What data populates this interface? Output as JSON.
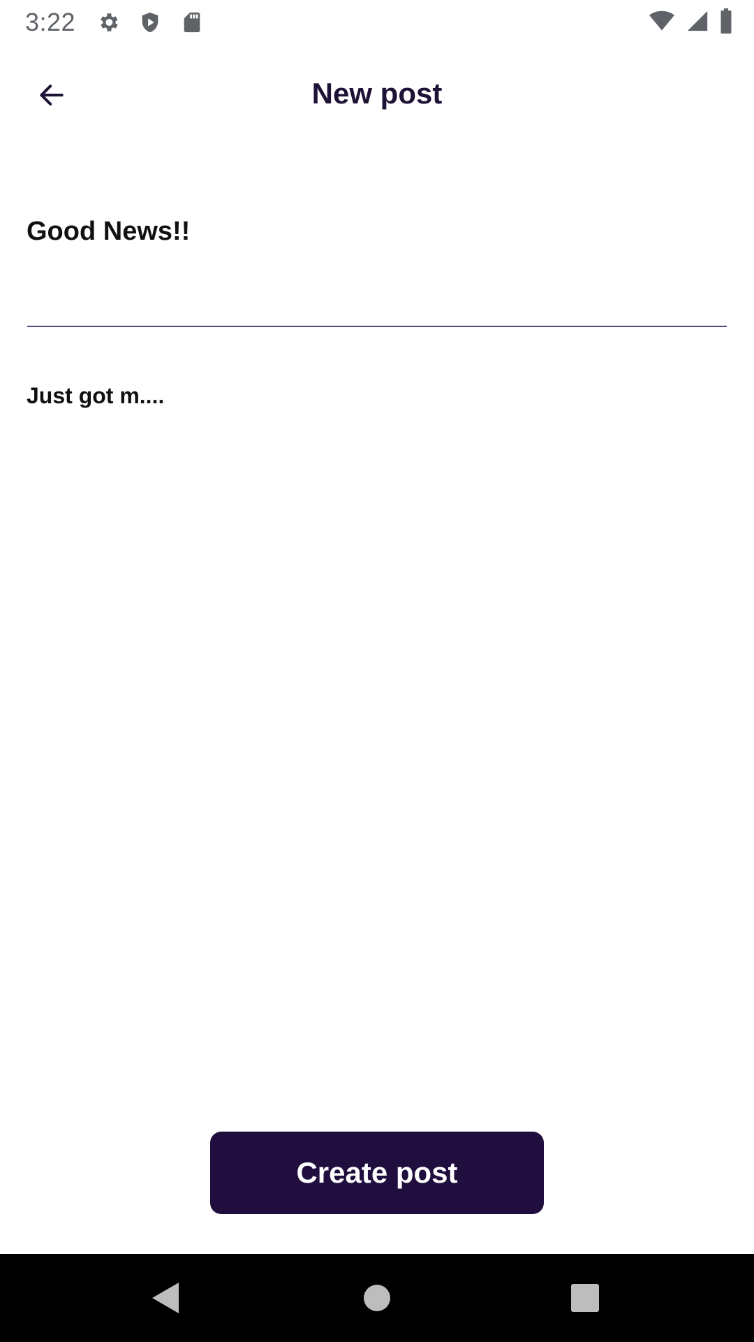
{
  "status_bar": {
    "time": "3:22",
    "left_icons": [
      "gear-icon",
      "shield-play-icon",
      "sd-card-icon"
    ],
    "right_icons": [
      "wifi-icon",
      "cell-signal-icon",
      "battery-icon"
    ]
  },
  "app_bar": {
    "title": "New post",
    "back_icon": "arrow-left-icon"
  },
  "form": {
    "title_value": "Good News!!",
    "body_value": "Just got m...."
  },
  "actions": {
    "create_label": "Create post"
  },
  "nav_bar": {
    "icons": [
      "nav-back-icon",
      "nav-home-icon",
      "nav-recents-icon"
    ]
  },
  "colors": {
    "primary": "#200e3e",
    "title_text": "#1e1236",
    "underline": "#4a4a8a",
    "status_icon": "#5f6368"
  }
}
